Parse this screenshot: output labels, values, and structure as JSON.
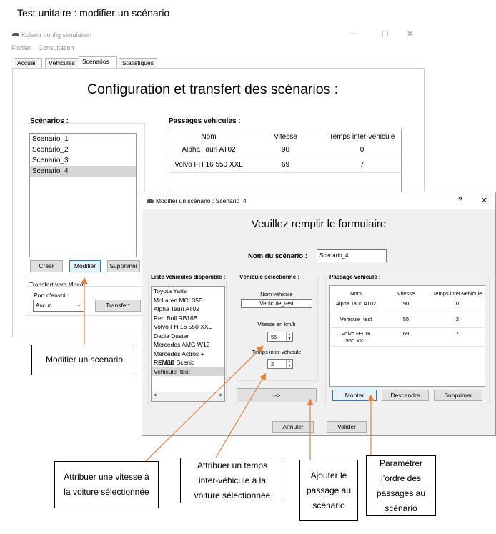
{
  "doc_title": "Test unitaire : modifier un scénario",
  "main_window": {
    "title": "Kolantr config simulation",
    "controls": {
      "minimize": "—",
      "maximize": "☐",
      "close": "✕"
    },
    "menu": [
      "Fichier",
      "Consultation"
    ],
    "tabs": [
      "Accueil",
      "Véhicules",
      "Scénarios",
      "Statistiques"
    ],
    "active_tab": "Scénarios",
    "heading": "Configuration et transfert des scénarios :",
    "scenarios_label": "Scénarios :",
    "scenarios": [
      "Scenario_1",
      "Scenario_2",
      "Scenario_3",
      "Scenario_4"
    ],
    "selected_scenario": "Scenario_4",
    "buttons": {
      "create": "Créer",
      "modify": "Modifier",
      "delete": "Supprimer"
    },
    "transfer_group_label": "Transfert vers Mbed",
    "port_label": "Port d'envoi :",
    "port_value": "Aucun",
    "transfer_button": "Transfert",
    "passages_label": "Passages vehicules :",
    "passages_columns": [
      "Nom",
      "Vitesse",
      "Temps inter-vehicule"
    ],
    "passages_rows": [
      [
        "Alpha Tauri AT02",
        "90",
        "0"
      ],
      [
        "Volvo FH 16 550 XXL",
        "69",
        "7"
      ]
    ]
  },
  "dialog": {
    "title": "Modifier un scénario : Scenario_4",
    "help": "?",
    "close": "✕",
    "heading": "Veuillez remplir le formulaire",
    "scenario_name_label": "Nom du scénario :",
    "scenario_name_value": "Scenario_4",
    "vehicles_list_label": "Liste véhicules disponible :",
    "vehicles": [
      "Toyota Yaris",
      "McLaren MCL35B",
      "Alpha Tauri AT02",
      "Red Bull RB16B",
      "Volvo FH 16 550 XXL",
      "Dacia Duster",
      "Mercedes AMG W12",
      "Mercedes Actros + REM3E",
      "Renault Scenic",
      "Vehicule_test"
    ],
    "selected_vehicle_index": 9,
    "selected_vehicle_label": "Véhicule sélectionné :",
    "vehicle_name_label": "Nom véhicule",
    "vehicle_name_value": "Vehicule_test",
    "speed_label": "Vitesse en km/h",
    "speed_value": "55",
    "inter_time_label": "Temps inter-véhicule",
    "inter_time_value": "2",
    "add_button": "-->",
    "passage_label": "Passage vehicule :",
    "passage_columns": [
      "Nom",
      "Vitesse",
      "Temps inter-vehicule"
    ],
    "passage_rows": [
      [
        "Alpha Tauri AT02",
        "90",
        "0"
      ],
      [
        "Vehicule_test",
        "55",
        "2"
      ],
      [
        "Volvo FH 16 550 XXL",
        "69",
        "7"
      ]
    ],
    "buttons": {
      "up": "Monter",
      "down": "Descendre",
      "delete": "Supprimer",
      "cancel": "Annuler",
      "validate": "Valider"
    }
  },
  "callouts": {
    "modify": "Modifier un scenario",
    "speed": "Attribuer une vitesse à la voiture sélectionnée",
    "inter_time": "Attribuer un temps inter-véhicule à la voiture sélectionnée",
    "add": "Ajouter le passage au scénario",
    "order": "Paramétrer l’ordre des passages au scénario"
  },
  "colors": {
    "arrow": "#ed7d31",
    "accent": "#2a7ad5",
    "selection": "#d6d6d6"
  }
}
